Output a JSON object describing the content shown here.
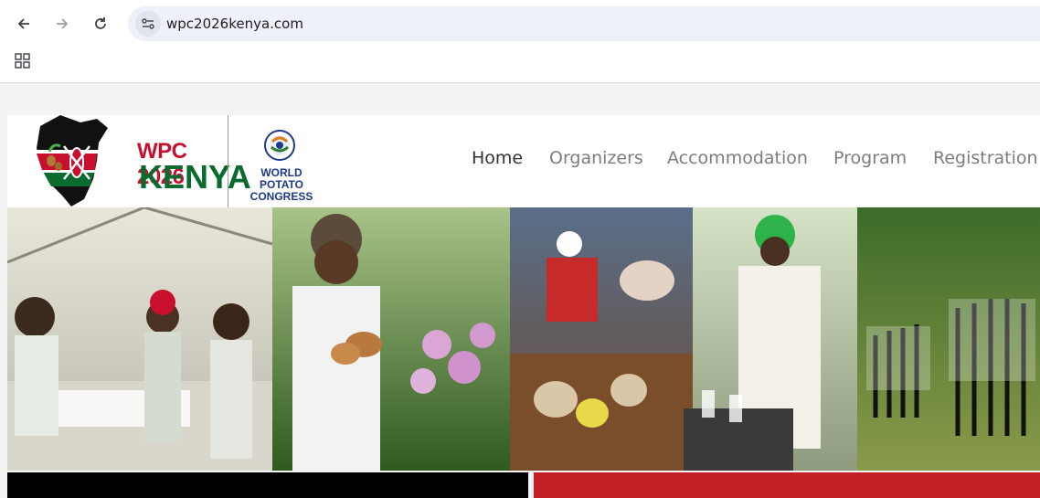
{
  "browser": {
    "url": "wpc2026kenya.com",
    "icons": [
      "back-arrow-icon",
      "forward-arrow-icon",
      "reload-icon",
      "site-info-icon",
      "apps-grid-icon"
    ]
  },
  "logo": {
    "line1": "WPC 2026",
    "line2": "KENYA",
    "partner_line1": "WORLD POTATO",
    "partner_line2": "CONGRESS"
  },
  "nav": {
    "items": [
      {
        "label": "Home",
        "active": true
      },
      {
        "label": "Organizers",
        "active": false
      },
      {
        "label": "Accommodation",
        "active": false
      },
      {
        "label": "Program",
        "active": false
      },
      {
        "label": "Registration",
        "active": false
      }
    ]
  },
  "colors": {
    "kenya_red": "#c8102e",
    "kenya_green": "#0a6b2e",
    "strip_black": "#000000",
    "strip_red": "#c21f26",
    "partner_blue": "#1f3a8a"
  }
}
